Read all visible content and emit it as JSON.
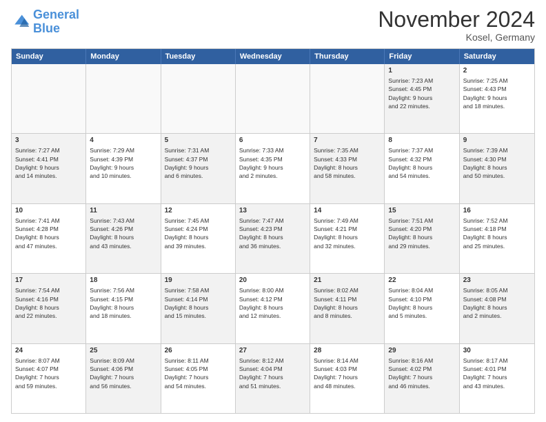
{
  "logo": {
    "line1": "General",
    "line2": "Blue"
  },
  "title": "November 2024",
  "location": "Kosel, Germany",
  "header": {
    "days": [
      "Sunday",
      "Monday",
      "Tuesday",
      "Wednesday",
      "Thursday",
      "Friday",
      "Saturday"
    ]
  },
  "rows": [
    [
      {
        "day": "",
        "text": "",
        "empty": true
      },
      {
        "day": "",
        "text": "",
        "empty": true
      },
      {
        "day": "",
        "text": "",
        "empty": true
      },
      {
        "day": "",
        "text": "",
        "empty": true
      },
      {
        "day": "",
        "text": "",
        "empty": true
      },
      {
        "day": "1",
        "text": "Sunrise: 7:23 AM\nSunset: 4:45 PM\nDaylight: 9 hours\nand 22 minutes.",
        "shaded": true
      },
      {
        "day": "2",
        "text": "Sunrise: 7:25 AM\nSunset: 4:43 PM\nDaylight: 9 hours\nand 18 minutes.",
        "shaded": false
      }
    ],
    [
      {
        "day": "3",
        "text": "Sunrise: 7:27 AM\nSunset: 4:41 PM\nDaylight: 9 hours\nand 14 minutes.",
        "shaded": true
      },
      {
        "day": "4",
        "text": "Sunrise: 7:29 AM\nSunset: 4:39 PM\nDaylight: 9 hours\nand 10 minutes.",
        "shaded": false
      },
      {
        "day": "5",
        "text": "Sunrise: 7:31 AM\nSunset: 4:37 PM\nDaylight: 9 hours\nand 6 minutes.",
        "shaded": true
      },
      {
        "day": "6",
        "text": "Sunrise: 7:33 AM\nSunset: 4:35 PM\nDaylight: 9 hours\nand 2 minutes.",
        "shaded": false
      },
      {
        "day": "7",
        "text": "Sunrise: 7:35 AM\nSunset: 4:33 PM\nDaylight: 8 hours\nand 58 minutes.",
        "shaded": true
      },
      {
        "day": "8",
        "text": "Sunrise: 7:37 AM\nSunset: 4:32 PM\nDaylight: 8 hours\nand 54 minutes.",
        "shaded": false
      },
      {
        "day": "9",
        "text": "Sunrise: 7:39 AM\nSunset: 4:30 PM\nDaylight: 8 hours\nand 50 minutes.",
        "shaded": true
      }
    ],
    [
      {
        "day": "10",
        "text": "Sunrise: 7:41 AM\nSunset: 4:28 PM\nDaylight: 8 hours\nand 47 minutes.",
        "shaded": false
      },
      {
        "day": "11",
        "text": "Sunrise: 7:43 AM\nSunset: 4:26 PM\nDaylight: 8 hours\nand 43 minutes.",
        "shaded": true
      },
      {
        "day": "12",
        "text": "Sunrise: 7:45 AM\nSunset: 4:24 PM\nDaylight: 8 hours\nand 39 minutes.",
        "shaded": false
      },
      {
        "day": "13",
        "text": "Sunrise: 7:47 AM\nSunset: 4:23 PM\nDaylight: 8 hours\nand 36 minutes.",
        "shaded": true
      },
      {
        "day": "14",
        "text": "Sunrise: 7:49 AM\nSunset: 4:21 PM\nDaylight: 8 hours\nand 32 minutes.",
        "shaded": false
      },
      {
        "day": "15",
        "text": "Sunrise: 7:51 AM\nSunset: 4:20 PM\nDaylight: 8 hours\nand 29 minutes.",
        "shaded": true
      },
      {
        "day": "16",
        "text": "Sunrise: 7:52 AM\nSunset: 4:18 PM\nDaylight: 8 hours\nand 25 minutes.",
        "shaded": false
      }
    ],
    [
      {
        "day": "17",
        "text": "Sunrise: 7:54 AM\nSunset: 4:16 PM\nDaylight: 8 hours\nand 22 minutes.",
        "shaded": true
      },
      {
        "day": "18",
        "text": "Sunrise: 7:56 AM\nSunset: 4:15 PM\nDaylight: 8 hours\nand 18 minutes.",
        "shaded": false
      },
      {
        "day": "19",
        "text": "Sunrise: 7:58 AM\nSunset: 4:14 PM\nDaylight: 8 hours\nand 15 minutes.",
        "shaded": true
      },
      {
        "day": "20",
        "text": "Sunrise: 8:00 AM\nSunset: 4:12 PM\nDaylight: 8 hours\nand 12 minutes.",
        "shaded": false
      },
      {
        "day": "21",
        "text": "Sunrise: 8:02 AM\nSunset: 4:11 PM\nDaylight: 8 hours\nand 8 minutes.",
        "shaded": true
      },
      {
        "day": "22",
        "text": "Sunrise: 8:04 AM\nSunset: 4:10 PM\nDaylight: 8 hours\nand 5 minutes.",
        "shaded": false
      },
      {
        "day": "23",
        "text": "Sunrise: 8:05 AM\nSunset: 4:08 PM\nDaylight: 8 hours\nand 2 minutes.",
        "shaded": true
      }
    ],
    [
      {
        "day": "24",
        "text": "Sunrise: 8:07 AM\nSunset: 4:07 PM\nDaylight: 7 hours\nand 59 minutes.",
        "shaded": false
      },
      {
        "day": "25",
        "text": "Sunrise: 8:09 AM\nSunset: 4:06 PM\nDaylight: 7 hours\nand 56 minutes.",
        "shaded": true
      },
      {
        "day": "26",
        "text": "Sunrise: 8:11 AM\nSunset: 4:05 PM\nDaylight: 7 hours\nand 54 minutes.",
        "shaded": false
      },
      {
        "day": "27",
        "text": "Sunrise: 8:12 AM\nSunset: 4:04 PM\nDaylight: 7 hours\nand 51 minutes.",
        "shaded": true
      },
      {
        "day": "28",
        "text": "Sunrise: 8:14 AM\nSunset: 4:03 PM\nDaylight: 7 hours\nand 48 minutes.",
        "shaded": false
      },
      {
        "day": "29",
        "text": "Sunrise: 8:16 AM\nSunset: 4:02 PM\nDaylight: 7 hours\nand 46 minutes.",
        "shaded": true
      },
      {
        "day": "30",
        "text": "Sunrise: 8:17 AM\nSunset: 4:01 PM\nDaylight: 7 hours\nand 43 minutes.",
        "shaded": false
      }
    ]
  ]
}
